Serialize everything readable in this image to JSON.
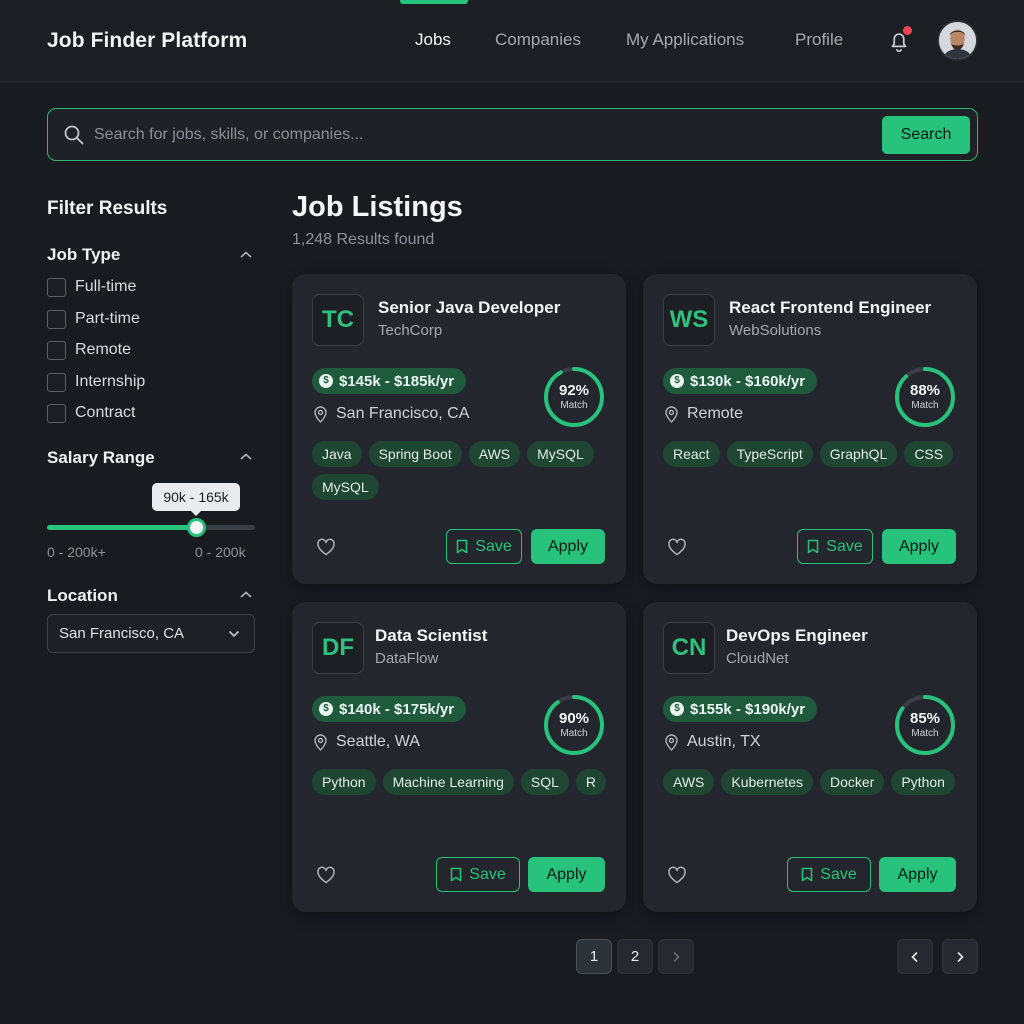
{
  "header": {
    "brand": "Job Finder Platform",
    "nav": [
      "Jobs",
      "Companies",
      "My Applications",
      "Profile"
    ],
    "active_nav": "Jobs",
    "has_notification": true
  },
  "search": {
    "placeholder": "Search for jobs, skills, or companies...",
    "value": "",
    "button_label": "Search"
  },
  "sidebar": {
    "title": "Filter Results",
    "job_type": {
      "heading": "Job Type",
      "options": [
        "Full-time",
        "Part-time",
        "Remote",
        "Internship",
        "Contract"
      ]
    },
    "salary": {
      "heading": "Salary Range",
      "tooltip": "90k - 165k",
      "min_label": "0 - 200k+",
      "max_label": "0 - 200k",
      "slider_value_fraction": 0.72
    },
    "location": {
      "heading": "Location",
      "selected": "San Francisco, CA"
    }
  },
  "main": {
    "title": "Job Listings",
    "results": "1,248 Results found"
  },
  "jobs": [
    {
      "logo": "TC",
      "title": "Senior Java Developer",
      "company": "TechCorp",
      "salary": "$145k - $185k/yr",
      "location": "San Francisco, CA",
      "match": "92%",
      "match_value": 92,
      "match_label": "Match",
      "tags": [
        "Java",
        "Spring Boot",
        "AWS",
        "MySQL",
        "MySQL"
      ],
      "save_label": "Save",
      "apply_label": "Apply"
    },
    {
      "logo": "WS",
      "title": "React Frontend Engineer",
      "company": "WebSolutions",
      "salary": "$130k - $160k/yr",
      "location": "Remote",
      "match": "88%",
      "match_value": 88,
      "match_label": "Match",
      "tags": [
        "React",
        "TypeScript",
        "GraphQL",
        "CSS"
      ],
      "save_label": "Save",
      "apply_label": "Apply"
    },
    {
      "logo": "DF",
      "title": "Data Scientist",
      "company": "DataFlow",
      "salary": "$140k - $175k/yr",
      "location": "Seattle, WA",
      "match": "90%",
      "match_value": 90,
      "match_label": "Match",
      "tags": [
        "Python",
        "Machine Learning",
        "SQL",
        "R"
      ],
      "save_label": "Save",
      "apply_label": "Apply"
    },
    {
      "logo": "CN",
      "title": "DevOps Engineer",
      "company": "CloudNet",
      "salary": "$155k - $190k/yr",
      "location": "Austin, TX",
      "match": "85%",
      "match_value": 85,
      "match_label": "Match",
      "tags": [
        "AWS",
        "Kubernetes",
        "Docker",
        "Python"
      ],
      "save_label": "Save",
      "apply_label": "Apply"
    }
  ],
  "pagination": {
    "pages": [
      "1",
      "2"
    ],
    "current": "1"
  },
  "colors": {
    "accent": "#27c27b",
    "background": "#181b20",
    "card": "#23272d",
    "tag_bg": "#1e4632",
    "notification": "#ef4452"
  },
  "icons": [
    "search-icon",
    "bell-icon",
    "chevron-up-icon",
    "chevron-down-icon",
    "dollar-icon",
    "map-pin-icon",
    "heart-icon",
    "bookmark-icon",
    "chevron-left-icon",
    "chevron-right-icon"
  ]
}
